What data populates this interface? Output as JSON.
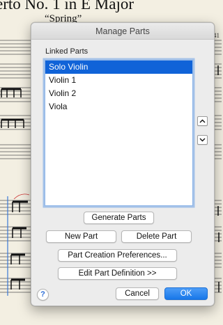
{
  "background_score": {
    "title": "erto No. 1 in E Major",
    "subtitle": "“Spring”",
    "page_number": "41"
  },
  "dialog": {
    "title": "Manage Parts",
    "linked_parts_label": "Linked Parts",
    "parts": [
      {
        "label": "Solo Violin",
        "selected": true
      },
      {
        "label": "Violin 1",
        "selected": false
      },
      {
        "label": "Violin 2",
        "selected": false
      },
      {
        "label": "Viola",
        "selected": false
      }
    ],
    "move_up_icon": "chevron-up-icon",
    "move_down_icon": "chevron-down-icon",
    "buttons": {
      "generate_parts": "Generate Parts",
      "new_part": "New Part",
      "delete_part": "Delete Part",
      "part_creation_preferences": "Part Creation Preferences...",
      "edit_part_definition": "Edit Part Definition >>",
      "cancel": "Cancel",
      "ok": "OK"
    },
    "help_label": "?"
  },
  "colors": {
    "selection": "#1063d8",
    "primary_button": "#1877e9",
    "focus_ring": "#8fb6e8",
    "paper": "#f3efe2"
  }
}
